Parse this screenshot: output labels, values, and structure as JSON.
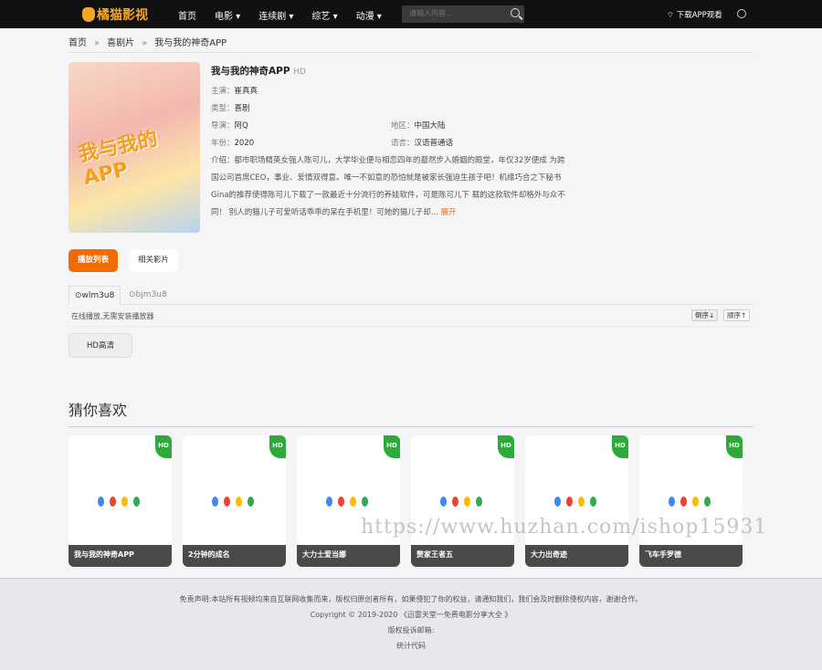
{
  "header": {
    "logo": "橘猫影视",
    "nav": [
      "首页",
      "电影 ▾",
      "连续剧 ▾",
      "综艺 ▾",
      "动漫 ▾"
    ],
    "search_placeholder": "请输入内容...",
    "download": "下载APP观看"
  },
  "breadcrumb": [
    "首页",
    "喜剧片",
    "我与我的神奇APP"
  ],
  "movie": {
    "poster_text": "我与我的APP",
    "title": "我与我的神奇APP",
    "quality": "HD",
    "actor_label": "主演：",
    "actor": "崔真真",
    "type_label": "类型：",
    "type": "喜剧",
    "director_label": "导演：",
    "director": "阿Q",
    "region_label": "地区：",
    "region": "中国大陆",
    "year_label": "年份：",
    "year": "2020",
    "lang_label": "语言：",
    "lang": "汉语普通话",
    "desc": "介绍：都市职场精英女强人陈可儿，大学毕业便与相恋四年的墓然步入婚姻的殿堂，年仅32岁便成 为跨国公司首席CEO，事业、爱情双得意。唯一不如意的恐怕就是被家长强迫生孩子吧！机缘巧合之下秘书Gina的推荐使得陈可儿下载了一款最近十分流行的养娃软件，可是陈可儿下 载的这款软件却格外与众不同！ 别人的猫儿子可爱听话乖乖的呆在手机里！可她的猫儿子却...",
    "more": "展开"
  },
  "buttons": {
    "playlist": "播放列表",
    "related": "相关影片"
  },
  "sources": {
    "tabs": [
      "wlm3u8",
      "bjm3u8"
    ],
    "note": "在线播放,无需安装播放器",
    "desc_sort": "倒序↓",
    "asc_sort": "顺序↑",
    "episode": "HD高清"
  },
  "recommend": {
    "title": "猜你喜欢",
    "badge": "HD",
    "items": [
      "我与我的神奇APP",
      "2分钟的成名",
      "大力士爱当娜",
      "赘家王者五",
      "大力出奇迹",
      "飞车手罗德"
    ]
  },
  "watermark": "https://www.huzhan.com/ishop15931",
  "footer": {
    "disclaimer": "免责声明:本站所有视频均来自互联网收集而来，版权归原创者所有，如果侵犯了你的权益，请通知我们，我们会及时删除侵权内容，谢谢合作。",
    "copyright": "Copyright © 2019-2020 《迅雷天堂一免费电影分享大全 》",
    "email": "版权投诉邮箱:",
    "stats": "统计代码"
  }
}
